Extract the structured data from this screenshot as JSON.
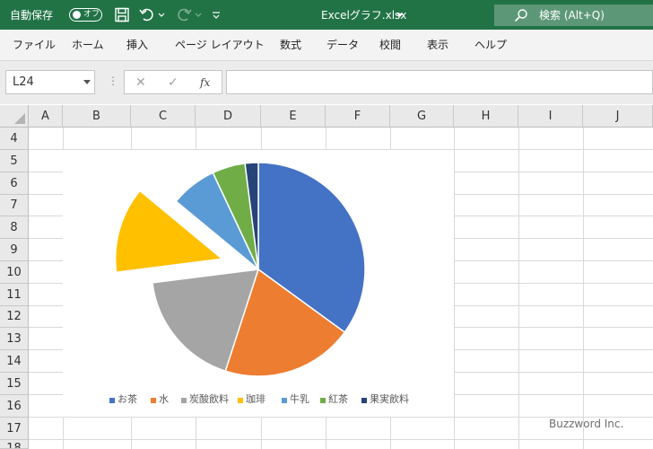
{
  "titlebar": {
    "autosave_label": "自動保存",
    "toggle_state": "オフ",
    "filename": "Excelグラフ.xlsx",
    "search_label": "検索 (Alt+Q)"
  },
  "menu": [
    "ファイル",
    "ホーム",
    "挿入",
    "ページ レイアウト",
    "数式",
    "データ",
    "校閲",
    "表示",
    "ヘルプ"
  ],
  "formula_bar": {
    "name_box": "L24",
    "fx": "fx",
    "cancel": "✕",
    "enter": "✓",
    "value": ""
  },
  "columns": [
    "A",
    "B",
    "C",
    "D",
    "E",
    "F",
    "G",
    "H",
    "I",
    "J"
  ],
  "rows": [
    "4",
    "5",
    "6",
    "7",
    "8",
    "9",
    "10",
    "11",
    "12",
    "13",
    "14",
    "15",
    "16",
    "17",
    "18"
  ],
  "chart_data": {
    "type": "pie",
    "categories": [
      "お茶",
      "水",
      "炭酸飲料",
      "珈琲",
      "牛乳",
      "紅茶",
      "果実飲料"
    ],
    "values": [
      35,
      20,
      18,
      13,
      7,
      5,
      2
    ],
    "colors": [
      "#4472C4",
      "#ED7D31",
      "#A5A5A5",
      "#FFC000",
      "#5B9BD5",
      "#70AD47",
      "#264478"
    ],
    "exploded": "珈琲",
    "legend_position": "bottom"
  },
  "watermark": "Buzzword Inc."
}
